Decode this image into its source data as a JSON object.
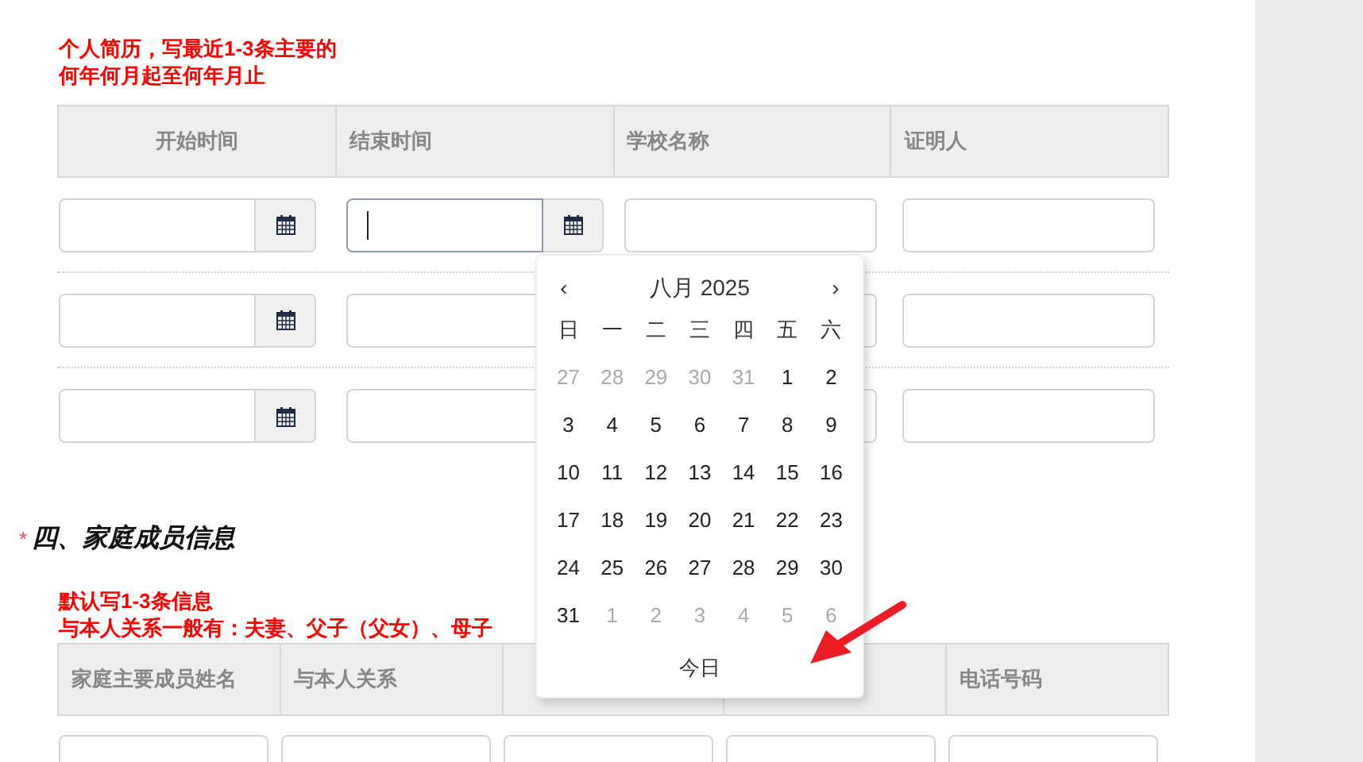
{
  "resume_note": [
    "个人简历，写最近1-3条主要的",
    "何年何月起至何年月止"
  ],
  "resume_table": {
    "columns": [
      {
        "label": "开始时间"
      },
      {
        "label": "结束时间"
      },
      {
        "label": "学校名称"
      },
      {
        "label": "证明人"
      }
    ],
    "rows": [
      {
        "start_focused": false,
        "end_focused": true
      },
      {
        "start_focused": false,
        "end_focused": false
      },
      {
        "start_focused": false,
        "end_focused": false
      }
    ]
  },
  "section": {
    "required_mark": "*",
    "title": "四、家庭成员信息"
  },
  "family_note": [
    "默认写1-3条信息",
    "与本人关系一般有：夫妻、父子（父女）、母子"
  ],
  "family_table": {
    "columns": [
      {
        "label": "家庭主要成员姓名"
      },
      {
        "label": "与本人关系"
      },
      {},
      {},
      {
        "label": "电话号码"
      }
    ]
  },
  "datepicker": {
    "prev": "‹",
    "title": "八月 2025",
    "next": "›",
    "weekdays": [
      "日",
      "一",
      "二",
      "三",
      "四",
      "五",
      "六"
    ],
    "days": [
      [
        {
          "text": "27",
          "muted": true
        },
        {
          "text": "28",
          "muted": true
        },
        {
          "text": "29",
          "muted": true
        },
        {
          "text": "30",
          "muted": true
        },
        {
          "text": "31",
          "muted": true
        },
        {
          "text": "1",
          "muted": false
        },
        {
          "text": "2",
          "muted": false
        }
      ],
      [
        {
          "text": "3",
          "muted": false
        },
        {
          "text": "4",
          "muted": false
        },
        {
          "text": "5",
          "muted": false
        },
        {
          "text": "6",
          "muted": false
        },
        {
          "text": "7",
          "muted": false
        },
        {
          "text": "8",
          "muted": false
        },
        {
          "text": "9",
          "muted": false
        }
      ],
      [
        {
          "text": "10",
          "muted": false
        },
        {
          "text": "11",
          "muted": false
        },
        {
          "text": "12",
          "muted": false
        },
        {
          "text": "13",
          "muted": false
        },
        {
          "text": "14",
          "muted": false
        },
        {
          "text": "15",
          "muted": false
        },
        {
          "text": "16",
          "muted": false
        }
      ],
      [
        {
          "text": "17",
          "muted": false
        },
        {
          "text": "18",
          "muted": false
        },
        {
          "text": "19",
          "muted": false
        },
        {
          "text": "20",
          "muted": false
        },
        {
          "text": "21",
          "muted": false
        },
        {
          "text": "22",
          "muted": false
        },
        {
          "text": "23",
          "muted": false
        }
      ],
      [
        {
          "text": "24",
          "muted": false
        },
        {
          "text": "25",
          "muted": false
        },
        {
          "text": "26",
          "muted": false
        },
        {
          "text": "27",
          "muted": false
        },
        {
          "text": "28",
          "muted": false
        },
        {
          "text": "29",
          "muted": false
        },
        {
          "text": "30",
          "muted": false
        }
      ],
      [
        {
          "text": "31",
          "muted": false
        },
        {
          "text": "1",
          "muted": true
        },
        {
          "text": "2",
          "muted": true
        },
        {
          "text": "3",
          "muted": true
        },
        {
          "text": "4",
          "muted": true
        },
        {
          "text": "5",
          "muted": true
        },
        {
          "text": "6",
          "muted": true
        }
      ]
    ],
    "today": "今日"
  }
}
